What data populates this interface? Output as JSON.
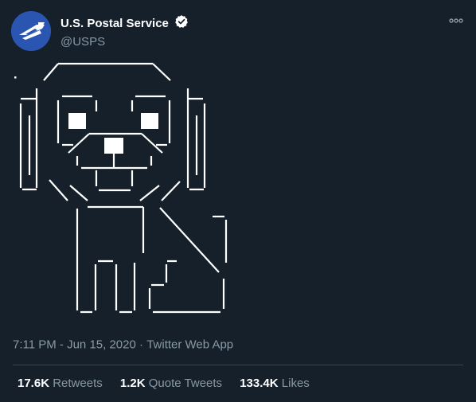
{
  "user": {
    "display_name": "U.S. Postal Service",
    "handle": "@USPS",
    "verified": true,
    "avatar_icon": "usps-eagle-logo-icon"
  },
  "tweet": {
    "content_art": "ascii-dog-drawing",
    "time": "7:11 PM",
    "date": "Jun 15, 2020",
    "separator": "·",
    "source": "Twitter Web App"
  },
  "stats": {
    "retweets_count": "17.6K",
    "retweets_label": "Retweets",
    "quote_count": "1.2K",
    "quote_label": "Quote Tweets",
    "likes_count": "133.4K",
    "likes_label": "Likes"
  },
  "colors": {
    "background": "#15202b",
    "secondary_text": "#8899a6",
    "divider": "#38444d",
    "avatar_bg": "#2a56b2"
  }
}
